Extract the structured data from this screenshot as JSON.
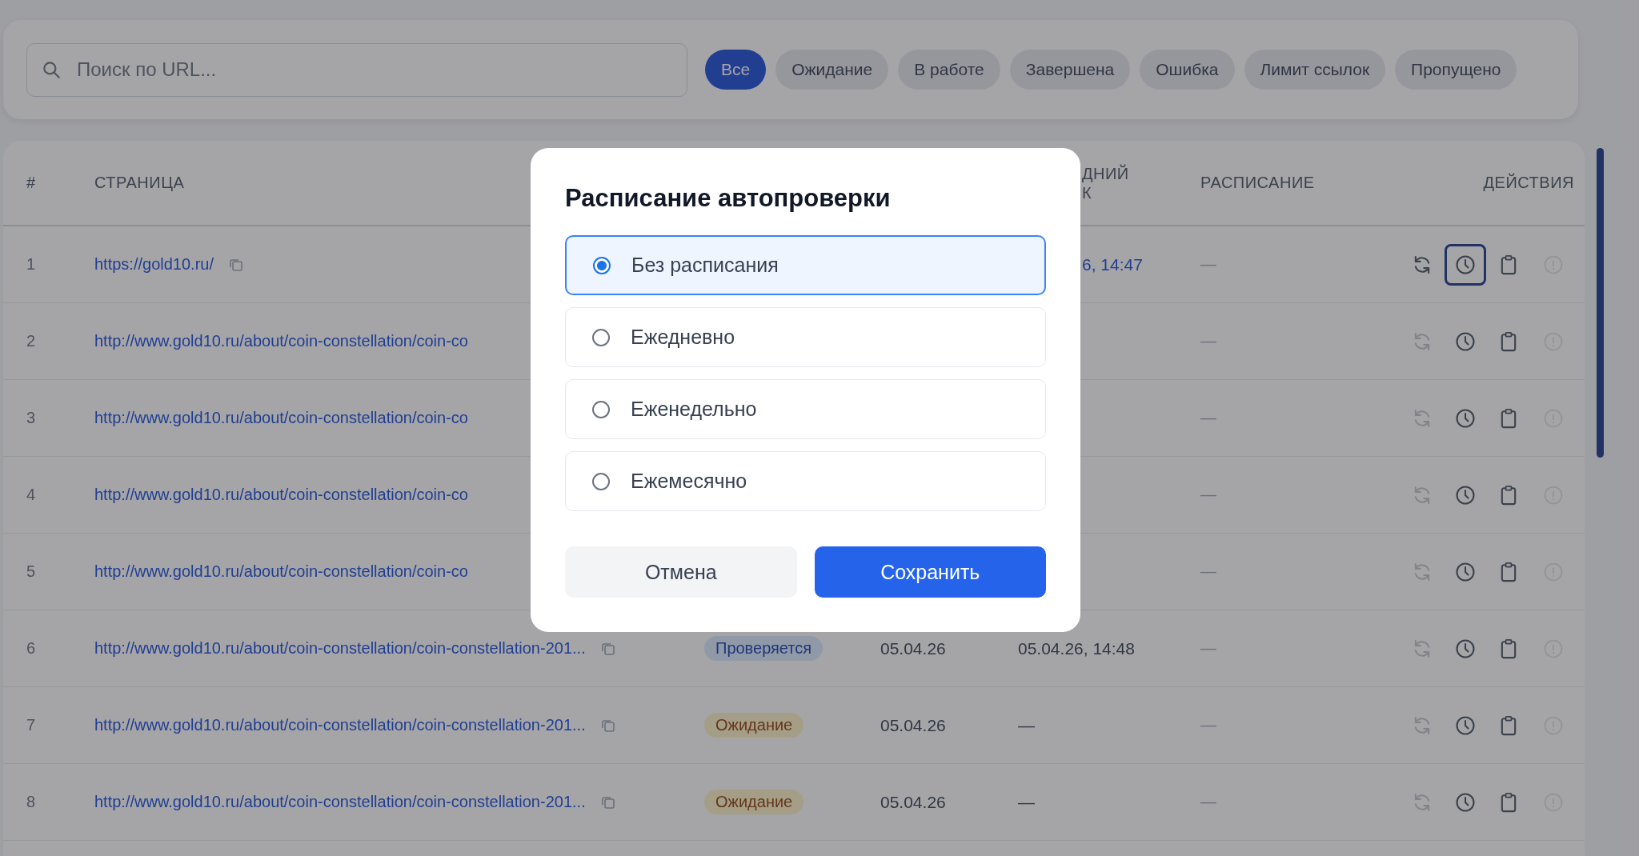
{
  "search": {
    "placeholder": "Поиск по URL..."
  },
  "filters": [
    {
      "label": "Все",
      "selected": true
    },
    {
      "label": "Ожидание",
      "selected": false
    },
    {
      "label": "В работе",
      "selected": false
    },
    {
      "label": "Завершена",
      "selected": false
    },
    {
      "label": "Ошибка",
      "selected": false
    },
    {
      "label": "Лимит ссылок",
      "selected": false
    },
    {
      "label": "Пропущено",
      "selected": false
    }
  ],
  "table": {
    "header": {
      "number": "#",
      "page": "СТРАНИЦА",
      "column_5": [
        "ДНИЙ",
        "К"
      ],
      "schedule": "РАСПИСАНИЕ",
      "actions": "ДЕЙСТВИЯ"
    },
    "rows": [
      {
        "number": "1",
        "url": "https://gold10.ru/",
        "copy_visible": true,
        "column_5": "6, 14:47",
        "column_5_cut": true,
        "schedule": "—",
        "refresh_enabled": true,
        "schedule_focused": true
      },
      {
        "number": "2",
        "url": "http://www.gold10.ru/about/coin-constellation/coin-co",
        "copy_visible": false,
        "schedule": "—",
        "refresh_enabled": false,
        "schedule_focused": false
      },
      {
        "number": "3",
        "url": "http://www.gold10.ru/about/coin-constellation/coin-co",
        "copy_visible": false,
        "schedule": "—",
        "refresh_enabled": false,
        "schedule_focused": false
      },
      {
        "number": "4",
        "url": "http://www.gold10.ru/about/coin-constellation/coin-co",
        "copy_visible": false,
        "schedule": "—",
        "refresh_enabled": false,
        "schedule_focused": false
      },
      {
        "number": "5",
        "url": "http://www.gold10.ru/about/coin-constellation/coin-co",
        "copy_visible": false,
        "schedule": "—",
        "refresh_enabled": false,
        "schedule_focused": false
      },
      {
        "number": "6",
        "url": "http://www.gold10.ru/about/coin-constellation/coin-constellation-201...",
        "copy_visible": true,
        "status": {
          "label": "Проверяется",
          "kind": "checking"
        },
        "date": "05.04.26",
        "column_5": "05.04.26, 14:48",
        "column_5_cut": false,
        "schedule": "—",
        "refresh_enabled": false,
        "schedule_focused": false
      },
      {
        "number": "7",
        "url": "http://www.gold10.ru/about/coin-constellation/coin-constellation-201...",
        "copy_visible": true,
        "status": {
          "label": "Ожидание",
          "kind": "pending"
        },
        "date": "05.04.26",
        "column_5": "—",
        "column_5_cut": false,
        "schedule": "—",
        "refresh_enabled": false,
        "schedule_focused": false
      },
      {
        "number": "8",
        "url": "http://www.gold10.ru/about/coin-constellation/coin-constellation-201...",
        "copy_visible": true,
        "status": {
          "label": "Ожидание",
          "kind": "pending"
        },
        "date": "05.04.26",
        "column_5": "—",
        "column_5_cut": false,
        "schedule": "—",
        "refresh_enabled": false,
        "schedule_focused": false
      }
    ]
  },
  "dialog": {
    "title": "Расписание автопроверки",
    "options": [
      {
        "label": "Без расписания",
        "selected": true
      },
      {
        "label": "Ежедневно",
        "selected": false
      },
      {
        "label": "Еженедельно",
        "selected": false
      },
      {
        "label": "Ежемесячно",
        "selected": false
      }
    ],
    "cancel": "Отмена",
    "save": "Сохранить"
  }
}
